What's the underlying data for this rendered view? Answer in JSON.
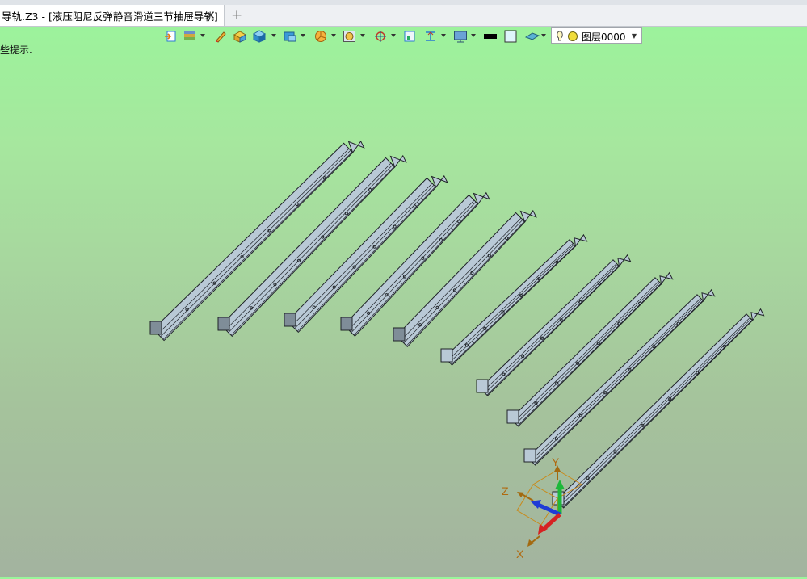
{
  "tab": {
    "title": "导轨.Z3 - [液压阻尼反弹静音滑道三节抽屉导轨]",
    "close": "✕",
    "add": "+"
  },
  "toolbar": {
    "icons": [
      "import-icon",
      "layer-manager-icon",
      "pen-icon",
      "solid-yellow-icon",
      "solid-cube-icon",
      "render-icon",
      "pie-filter-icon",
      "view-icon",
      "snap-target-icon",
      "frame-icon",
      "dimension-icon",
      "display-icon",
      "line-color-icon",
      "fill-color-icon",
      "plane-icon"
    ],
    "layer": "图层0000"
  },
  "hint": "些提示.",
  "axes": {
    "x": "X",
    "y": "Y",
    "z": "Z"
  },
  "colors": {
    "background_top": "#9af59b",
    "background_bottom": "#a3b39f",
    "rail": "#b9c9d6",
    "rail_edge": "#1f2328"
  },
  "scene": {
    "rail_count": 10
  }
}
